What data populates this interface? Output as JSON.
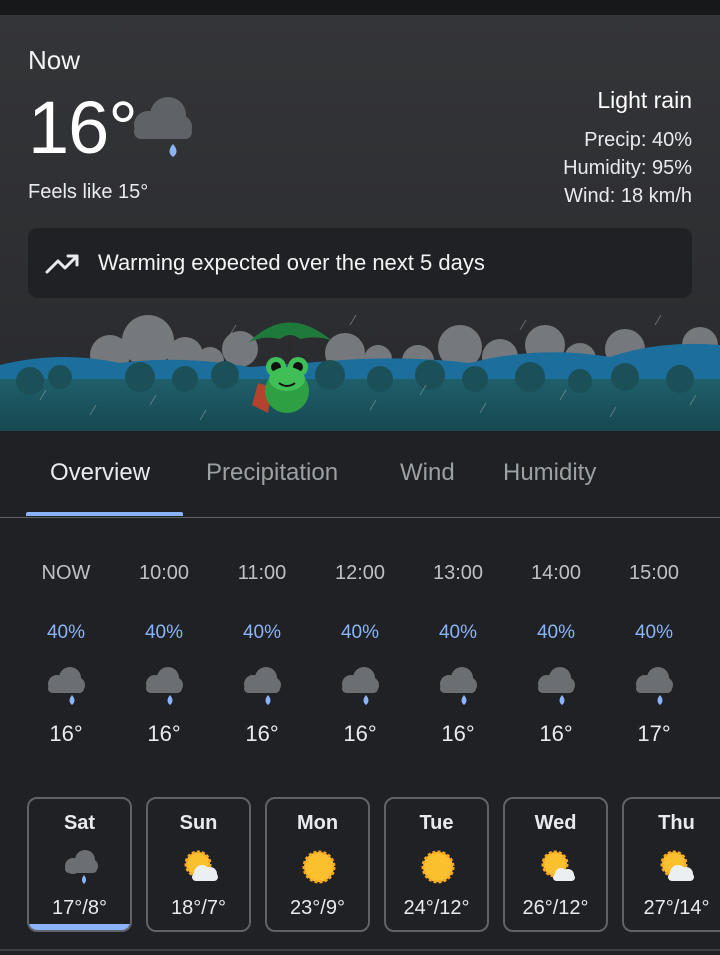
{
  "current": {
    "label": "Now",
    "temp": "16°",
    "feels_like": "Feels like 15°",
    "condition": "Light rain",
    "precip": "Precip: 40%",
    "humidity": "Humidity: 95%",
    "wind": "Wind: 18 km/h",
    "icon": "rain-cloud-icon"
  },
  "banner": {
    "icon": "trending-up-icon",
    "text": "Warming expected over the next 5 days"
  },
  "tabs": [
    {
      "label": "Overview",
      "active": true
    },
    {
      "label": "Precipitation",
      "active": false
    },
    {
      "label": "Wind",
      "active": false
    },
    {
      "label": "Humidity",
      "active": false
    }
  ],
  "hourly": [
    {
      "time": "NOW",
      "precip": "40%",
      "temp": "16°",
      "icon": "rain-cloud-icon"
    },
    {
      "time": "10:00",
      "precip": "40%",
      "temp": "16°",
      "icon": "rain-cloud-icon"
    },
    {
      "time": "11:00",
      "precip": "40%",
      "temp": "16°",
      "icon": "rain-cloud-icon"
    },
    {
      "time": "12:00",
      "precip": "40%",
      "temp": "16°",
      "icon": "rain-cloud-icon"
    },
    {
      "time": "13:00",
      "precip": "40%",
      "temp": "16°",
      "icon": "rain-cloud-icon"
    },
    {
      "time": "14:00",
      "precip": "40%",
      "temp": "16°",
      "icon": "rain-cloud-icon"
    },
    {
      "time": "15:00",
      "precip": "40%",
      "temp": "17°",
      "icon": "rain-cloud-icon"
    }
  ],
  "daily": [
    {
      "day": "Sat",
      "range": "17°/8°",
      "icon": "rain-cloud-icon",
      "selected": true
    },
    {
      "day": "Sun",
      "range": "18°/7°",
      "icon": "partly-cloudy-icon",
      "selected": false
    },
    {
      "day": "Mon",
      "range": "23°/9°",
      "icon": "sun-icon",
      "selected": false
    },
    {
      "day": "Tue",
      "range": "24°/12°",
      "icon": "sun-icon",
      "selected": false
    },
    {
      "day": "Wed",
      "range": "26°/12°",
      "icon": "partly-cloudy-icon",
      "selected": false
    },
    {
      "day": "Thu",
      "range": "27°/14°",
      "icon": "partly-cloudy-icon",
      "selected": false
    }
  ],
  "colors": {
    "accent": "#8ab4f8",
    "background": "#202124",
    "hero": "#343538",
    "card_border": "#5f6368"
  }
}
